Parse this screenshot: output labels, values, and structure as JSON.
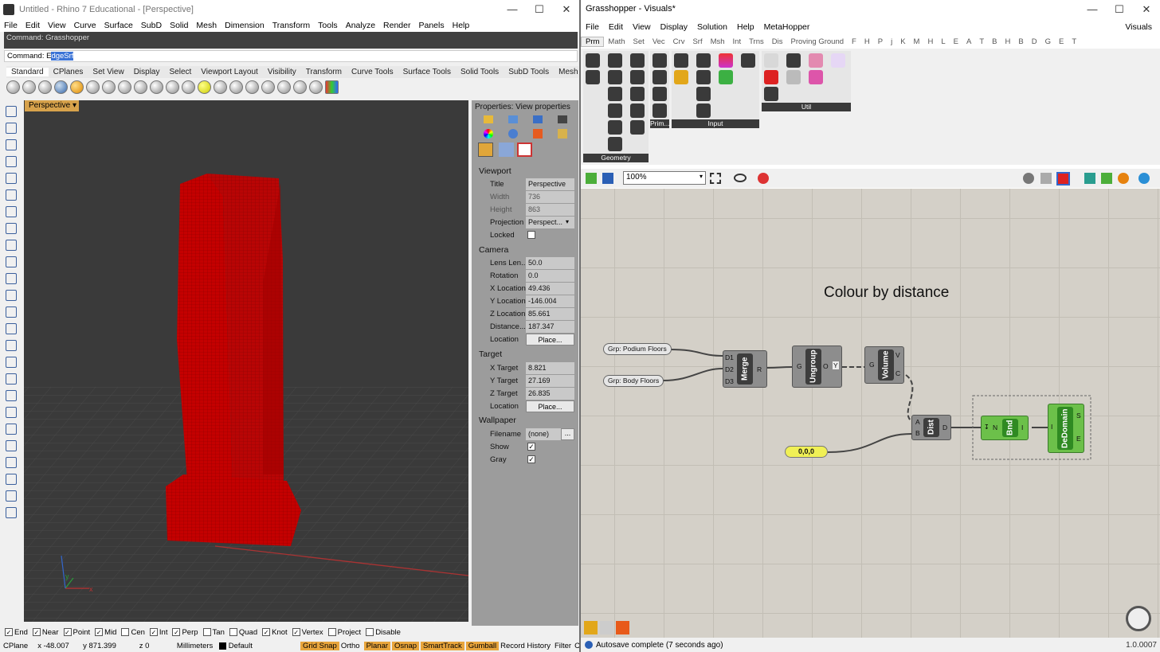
{
  "rhino": {
    "title": "Untitled - Rhino 7 Educational - [Perspective]",
    "menu": [
      "File",
      "Edit",
      "View",
      "Curve",
      "Surface",
      "SubD",
      "Solid",
      "Mesh",
      "Dimension",
      "Transform",
      "Tools",
      "Analyze",
      "Render",
      "Panels",
      "Help"
    ],
    "command_history": "Command: Grasshopper",
    "command_prefix": "Command: ",
    "command_value_first": "E",
    "command_value_selected": "dgeSrf",
    "tabs": [
      "Standard",
      "CPlanes",
      "Set View",
      "Display",
      "Select",
      "Viewport Layout",
      "Visibility",
      "Transform",
      "Curve Tools",
      "Surface Tools",
      "Solid Tools",
      "SubD Tools",
      "Mesh"
    ],
    "viewport_label": "Perspective",
    "axis_y": "y",
    "axis_x": "x",
    "props": {
      "header": "Properties: View properties",
      "viewport_section": "Viewport",
      "title_label": "Title",
      "title_value": "Perspective",
      "width_label": "Width",
      "width_value": "736",
      "height_label": "Height",
      "height_value": "863",
      "projection_label": "Projection",
      "projection_value": "Perspect...",
      "locked_label": "Locked",
      "camera_section": "Camera",
      "lens_label": "Lens Len...",
      "lens_value": "50.0",
      "rotation_label": "Rotation",
      "rotation_value": "0.0",
      "xloc_label": "X Location",
      "xloc_value": "49.436",
      "yloc_label": "Y Location",
      "yloc_value": "-146.004",
      "zloc_label": "Z Location",
      "zloc_value": "85.661",
      "dist_label": "Distance...",
      "dist_value": "187.347",
      "location_label": "Location",
      "place_button": "Place...",
      "target_section": "Target",
      "xt_label": "X Target",
      "xt_value": "8.821",
      "yt_label": "Y Target",
      "yt_value": "27.169",
      "zt_label": "Z Target",
      "zt_value": "26.835",
      "wallpaper_section": "Wallpaper",
      "filename_label": "Filename",
      "filename_value": "(none)",
      "browse_button": "...",
      "show_label": "Show",
      "gray_label": "Gray"
    },
    "osnaps": [
      {
        "label": "End",
        "checked": true
      },
      {
        "label": "Near",
        "checked": true
      },
      {
        "label": "Point",
        "checked": true
      },
      {
        "label": "Mid",
        "checked": true
      },
      {
        "label": "Cen",
        "checked": false
      },
      {
        "label": "Int",
        "checked": true
      },
      {
        "label": "Perp",
        "checked": true
      },
      {
        "label": "Tan",
        "checked": false
      },
      {
        "label": "Quad",
        "checked": false
      },
      {
        "label": "Knot",
        "checked": true
      },
      {
        "label": "Vertex",
        "checked": true
      },
      {
        "label": "Project",
        "checked": false
      },
      {
        "label": "Disable",
        "checked": false
      }
    ],
    "status": {
      "cplane": "CPlane",
      "x": "x -48.007",
      "y": "y 871.399",
      "z": "z 0",
      "units": "Millimeters",
      "layer": "Default",
      "grid_snap": "Grid Snap",
      "ortho": "Ortho",
      "planar": "Planar",
      "osnap": "Osnap",
      "smarttrack": "SmartTrack",
      "gumball": "Gumball",
      "record_history": "Record History",
      "filter": "Filter",
      "filter_tail": "C"
    },
    "colors": {
      "geometry": "#c00000",
      "viewport_bg": "#3a3a3a",
      "highlight": "#e8a53c"
    }
  },
  "gh": {
    "title": "Grasshopper - Visuals*",
    "menu": [
      "File",
      "Edit",
      "View",
      "Display",
      "Solution",
      "Help",
      "MetaHopper"
    ],
    "menu_right": "Visuals",
    "tabs": [
      "Prm",
      "Math",
      "Set",
      "Vec",
      "Crv",
      "Srf",
      "Msh",
      "Int",
      "Trns",
      "Dis",
      "Proving Ground",
      "F",
      "H",
      "P",
      "j",
      "K",
      "M",
      "H",
      "L",
      "E",
      "A",
      "T",
      "B",
      "H",
      "B",
      "D",
      "G",
      "E",
      "T"
    ],
    "palette_geometry": "Geometry",
    "palette_prim": "Prim...",
    "palette_input": "Input",
    "palette_util": "Util",
    "zoom": "100%",
    "heading": "Colour by distance",
    "grp_podium": "Grp: Podium Floors",
    "grp_body": "Grp: Body Floors",
    "merge": {
      "name": "Merge",
      "in": [
        "D1",
        "D2",
        "D3"
      ],
      "out": "R"
    },
    "ungroup": {
      "name": "Ungroup",
      "in": "G",
      "out1": "O",
      "out2": "Y"
    },
    "volume": {
      "name": "Volume",
      "in": "G",
      "out1": "V",
      "out2": "C"
    },
    "dist": {
      "name": "Dist",
      "in1": "A",
      "in2": "B",
      "out": "D"
    },
    "bnd": {
      "name": "Bnd",
      "in": "N",
      "out": "I"
    },
    "dedomain": {
      "name": "DeDomain",
      "in": "I",
      "out1": "S",
      "out2": "E"
    },
    "panel_point": "0,0,0",
    "status": "Autosave complete (7 seconds ago)",
    "version": "1.0.0007",
    "colors": {
      "canvas": "#d4d0c8",
      "component": "#3d3d3d",
      "green_component": "#4cb83a",
      "panel": "#f0f055"
    }
  }
}
